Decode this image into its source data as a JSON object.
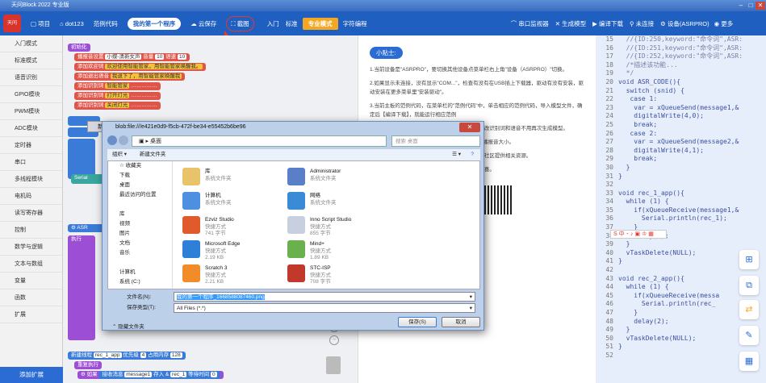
{
  "titlebar": {
    "title": "天问Block 2022 专业版"
  },
  "toolbar": {
    "project": "项目",
    "user": "dot123",
    "examples": "范例代码",
    "my_program": "我的第一个程序",
    "cloud_save": "云保存",
    "screenshot": "截图",
    "getting_started": "入门",
    "standard": "标准",
    "pro_mode": "专业模式",
    "char_program": "字符编程",
    "serial_monitor": "串口监视器",
    "generate_model": "生成模型",
    "compile_download": "编译下载",
    "not_connected": "未连接",
    "device": "设备(ASRPRO)",
    "more": "更多"
  },
  "leftnav": {
    "items": [
      "入门模式",
      "标准模式",
      "语音识别",
      "GPIO模块",
      "PWM模块",
      "ADC模块",
      "定时器",
      "串口",
      "多线程模块",
      "电机码",
      "读写寄存器",
      "控制",
      "数学与逻辑",
      "文本与数组",
      "变量",
      "函数",
      "扩展"
    ],
    "add_extension": "添加扩展"
  },
  "blocks": {
    "init": "初始化",
    "b1": "播报音设置",
    "b1v": "小蝶-清新女声",
    "b1a": "音量",
    "b1b": "10",
    "b1c": "语速",
    "b1d": "10",
    "b2": "添加欢迎词",
    "b2v": "欢迎使用智能管家，用智能管家唤醒我。",
    "b3": "添加退出语音",
    "b3v": "我退下了，用智能管家唤醒我",
    "b4": "添加识别词",
    "b4v": "智能管家",
    "b5": "添加识别词",
    "b5v": "打开灯光",
    "b6": "添加识别词",
    "b6v": "关闭灯光",
    "new_thread": "新建线程",
    "rec1": "rec_1_app",
    "priority": "优先级",
    "pri": "4",
    "mem": "占用内存",
    "memv": "128",
    "loop": "重复执行",
    "if": "如果",
    "recv": "接收消息",
    "msg": "message1",
    "store": "存入 &",
    "rec1b": "rec_1",
    "wait": "等待时间",
    "waitv": "0"
  },
  "tips": {
    "title": "小贴士:",
    "items": [
      "1.当前设备是\"ASRPRO\"，要切换其他设备点菜单栏右上角\"设备（ASRPRO）\"切换。",
      "2.如果显示未连接，没有显示\"COM...\"，检查有没有在USB插上下载器，驱动有没有安装，驱动安装在更多菜单里\"安装驱动\"。",
      "3.当前主板的范例代码，在菜单栏的\"范例代码\"中，单击相应的范例代码，导入模型文件，确定后【编译下载】，就能运行相应范例",
      "4.修改了程序中的识别词和播报音，修改程序中修改识别词和语音不用再次生成模型。",
      "5.修改音量和语速，在积木中修改\"最小音量\"修改播报音大小。",
      "6.更多帮助请关注我们的微信公众号、抖音学习、社区提供相关资源。",
      "7.如果遇到问题，请联系我们的客服，给你带来惊喜。"
    ]
  },
  "code": {
    "lines": [
      {
        "n": "15",
        "t": "  //{ID:250,keyword:\"命令词\",ASR:"
      },
      {
        "n": "16",
        "t": "  //{ID:251,keyword:\"命令词\",ASR:"
      },
      {
        "n": "17",
        "t": "  //{ID:252,keyword:\"命令词\",ASR:"
      },
      {
        "n": "18",
        "t": "  /*描述该功能..."
      },
      {
        "n": "19",
        "t": "  */"
      },
      {
        "n": "20",
        "t": "void ASR_CODE(){"
      },
      {
        "n": "21",
        "t": "  switch (snid) {"
      },
      {
        "n": "22",
        "t": "   case 1:"
      },
      {
        "n": "23",
        "t": "    var = xQueueSend(message1,&"
      },
      {
        "n": "24",
        "t": "    digitalWrite(4,0);"
      },
      {
        "n": "25",
        "t": "    break;"
      },
      {
        "n": "26",
        "t": "   case 2:"
      },
      {
        "n": "27",
        "t": "    var = xQueueSend(message2,&"
      },
      {
        "n": "28",
        "t": "    digitalWrite(4,1);"
      },
      {
        "n": "29",
        "t": "    break;"
      },
      {
        "n": "30",
        "t": "  }"
      },
      {
        "n": "31",
        "t": "}"
      },
      {
        "n": "32",
        "t": ""
      },
      {
        "n": "33",
        "t": "void rec_1_app(){"
      },
      {
        "n": "34",
        "t": "  while (1) {"
      },
      {
        "n": "35",
        "t": "    if(xQueueReceive(message1,&"
      },
      {
        "n": "36",
        "t": "      Serial.println(rec_1);"
      },
      {
        "n": "37",
        "t": "    }"
      },
      {
        "n": "38",
        "t": "    delay(2);"
      },
      {
        "n": "39",
        "t": "  }"
      },
      {
        "n": "40",
        "t": "  vTaskDelete(NULL);"
      },
      {
        "n": "41",
        "t": "}"
      },
      {
        "n": "42",
        "t": ""
      },
      {
        "n": "43",
        "t": "void rec_2_app(){"
      },
      {
        "n": "44",
        "t": "  while (1) {"
      },
      {
        "n": "45",
        "t": "    if(xQueueReceive(messa"
      },
      {
        "n": "46",
        "t": "      Serial.println(rec_"
      },
      {
        "n": "47",
        "t": "    }"
      },
      {
        "n": "48",
        "t": "    delay(2);"
      },
      {
        "n": "49",
        "t": "  }"
      },
      {
        "n": "50",
        "t": "  vTaskDelete(NULL);"
      },
      {
        "n": "51",
        "t": "}"
      },
      {
        "n": "52",
        "t": ""
      }
    ]
  },
  "dialog": {
    "title": "blob:file:///e421e0d9-f5cb-472f-be34-e55452b6be96",
    "address": "桌面",
    "search_placeholder": "搜索 桌面",
    "organize": "组织 ▾",
    "new_folder": "新建文件夹",
    "tree": [
      "☆ 收藏夹",
      "下载",
      "桌面",
      "最近访问的位置",
      "",
      "库",
      "视频",
      "图片",
      "文档",
      "音乐",
      "",
      "计算机",
      "系统 (C:)"
    ],
    "files": [
      {
        "name": "库",
        "sub": "系统文件夹",
        "sub2": ""
      },
      {
        "name": "Administrator",
        "sub": "系统文件夹",
        "sub2": ""
      },
      {
        "name": "计算机",
        "sub": "系统文件夹",
        "sub2": ""
      },
      {
        "name": "网络",
        "sub": "系统文件夹",
        "sub2": ""
      },
      {
        "name": "Ezviz Studio",
        "sub": "快捷方式",
        "sub2": "741 字节"
      },
      {
        "name": "Inno Script Studio",
        "sub": "快捷方式",
        "sub2": "855 字节"
      },
      {
        "name": "Microsoft Edge",
        "sub": "快捷方式",
        "sub2": "2.19 KB"
      },
      {
        "name": "Mind+",
        "sub": "快捷方式",
        "sub2": "1.89 KB"
      },
      {
        "name": "Scratch 3",
        "sub": "快捷方式",
        "sub2": "2.21 KB"
      },
      {
        "name": "STC-ISP",
        "sub": "快捷方式",
        "sub2": "708 字节"
      }
    ],
    "filename_label": "文件名(N):",
    "filename": "我的第一个程序_1668588087460.png",
    "type_label": "保存类型(T):",
    "type": "All Files (*.*)",
    "hide_folders": "隐藏文件夹",
    "save": "保存(S)",
    "cancel": "取消"
  }
}
